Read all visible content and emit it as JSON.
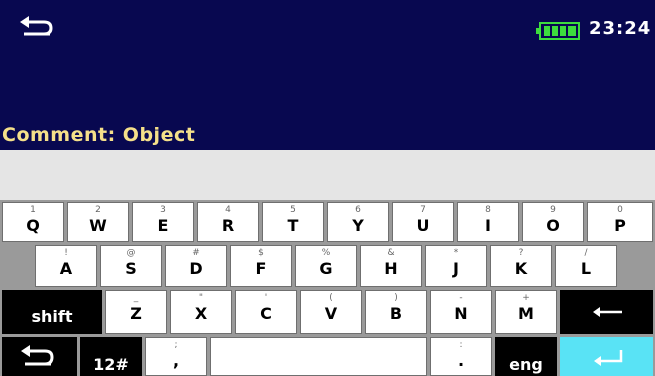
{
  "status": {
    "time": "23:24"
  },
  "comment_label": "Comment: Object",
  "keyboard": {
    "row1": [
      {
        "sup": "1",
        "label": "Q"
      },
      {
        "sup": "2",
        "label": "W"
      },
      {
        "sup": "3",
        "label": "E"
      },
      {
        "sup": "4",
        "label": "R"
      },
      {
        "sup": "5",
        "label": "T"
      },
      {
        "sup": "6",
        "label": "Y"
      },
      {
        "sup": "7",
        "label": "U"
      },
      {
        "sup": "8",
        "label": "I"
      },
      {
        "sup": "9",
        "label": "O"
      },
      {
        "sup": "0",
        "label": "P"
      }
    ],
    "row2": [
      {
        "sup": "!",
        "label": "A"
      },
      {
        "sup": "@",
        "label": "S"
      },
      {
        "sup": "#",
        "label": "D"
      },
      {
        "sup": "$",
        "label": "F"
      },
      {
        "sup": "%",
        "label": "G"
      },
      {
        "sup": "&",
        "label": "H"
      },
      {
        "sup": "*",
        "label": "J"
      },
      {
        "sup": "?",
        "label": "K"
      },
      {
        "sup": "/",
        "label": "L"
      }
    ],
    "row3": [
      {
        "sup": "_",
        "label": "Z"
      },
      {
        "sup": "\"",
        "label": "X"
      },
      {
        "sup": "'",
        "label": "C"
      },
      {
        "sup": "(",
        "label": "V"
      },
      {
        "sup": ")",
        "label": "B"
      },
      {
        "sup": "-",
        "label": "N"
      },
      {
        "sup": "+",
        "label": "M"
      }
    ],
    "shift_label": "shift",
    "numeric_label": "12#",
    "comma_sup": ";",
    "comma_label": ",",
    "period_sup": ":",
    "period_label": ".",
    "lang_label": "eng"
  }
}
